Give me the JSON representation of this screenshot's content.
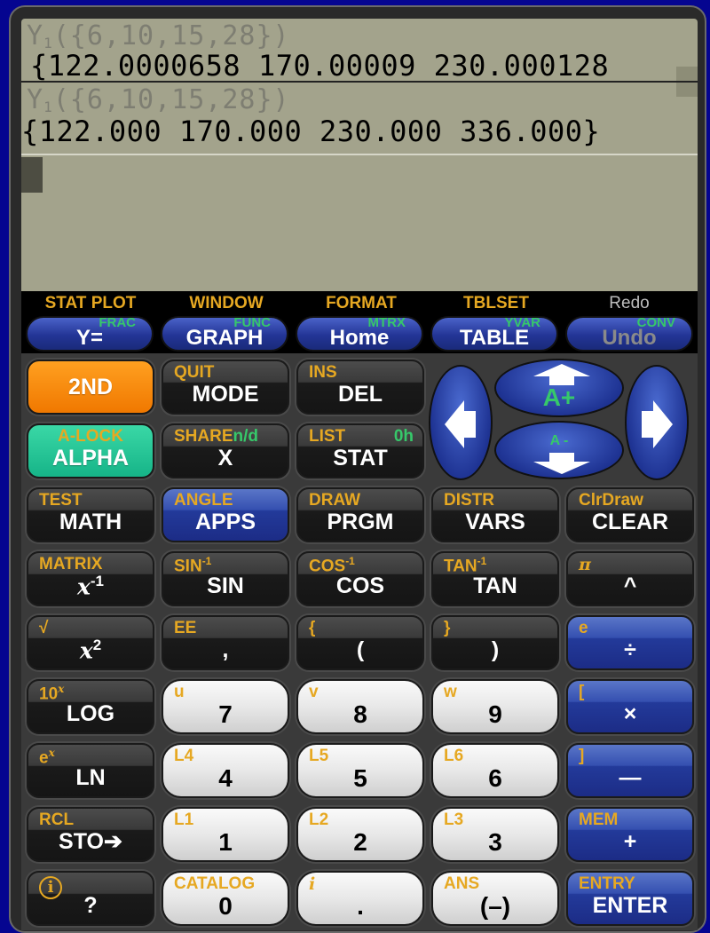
{
  "display": {
    "history": [
      {
        "expression": "Y",
        "subscript": "1",
        "args": "({6,10,15,28})",
        "result": "{122.0000658 170.00009 230.000128"
      },
      {
        "expression": "Y",
        "subscript": "1",
        "args": "({6,10,15,28})",
        "result": "{122.000 170.000 230.000 336.000}"
      }
    ]
  },
  "function_row": [
    {
      "second": "STAT PLOT",
      "alpha": "FRAC",
      "main": "Y="
    },
    {
      "second": "WINDOW",
      "alpha": "FUNC",
      "main": "GRAPH"
    },
    {
      "second": "FORMAT",
      "alpha": "MTRX",
      "main": "Home"
    },
    {
      "second": "TBLSET",
      "alpha": "YVAR",
      "main": "TABLE"
    },
    {
      "second": "Redo",
      "alpha": "CONV",
      "main": "Undo"
    }
  ],
  "dpad": {
    "up_label": "A+",
    "down_label": "A -"
  },
  "keys": {
    "second": {
      "main": "2ND"
    },
    "mode": {
      "second": "QUIT",
      "main": "MODE"
    },
    "del": {
      "second": "INS",
      "main": "DEL"
    },
    "alpha": {
      "second": "A-LOCK",
      "main": "ALPHA"
    },
    "x": {
      "second": "SHARE",
      "alpha": "n/d",
      "main": "X"
    },
    "stat": {
      "second": "LIST",
      "alpha": "0h",
      "main": "STAT"
    },
    "math": {
      "second": "TEST",
      "main": "MATH"
    },
    "apps": {
      "second": "ANGLE",
      "main": "APPS"
    },
    "prgm": {
      "second": "DRAW",
      "main": "PRGM"
    },
    "vars": {
      "second": "DISTR",
      "main": "VARS"
    },
    "clear": {
      "second": "ClrDraw",
      "main": "CLEAR"
    },
    "inverse": {
      "second": "MATRIX",
      "main": "x",
      "sup": "-1"
    },
    "sin": {
      "second": "SIN",
      "second_sup": "-1",
      "main": "SIN"
    },
    "cos": {
      "second": "COS",
      "second_sup": "-1",
      "main": "COS"
    },
    "tan": {
      "second": "TAN",
      "second_sup": "-1",
      "main": "TAN"
    },
    "power": {
      "second": "π",
      "main": "^"
    },
    "square": {
      "second": "√",
      "main": "x",
      "sup": "2"
    },
    "comma": {
      "second": "EE",
      "main": ","
    },
    "lparen": {
      "second": "{",
      "main": "("
    },
    "rparen": {
      "second": "}",
      "main": ")"
    },
    "divide": {
      "second": "e",
      "main": "÷"
    },
    "log": {
      "second": "10",
      "second_sup": "x",
      "main": "LOG"
    },
    "seven": {
      "second": "u",
      "main": "7"
    },
    "eight": {
      "second": "v",
      "main": "8"
    },
    "nine": {
      "second": "w",
      "main": "9"
    },
    "multiply": {
      "second": "[",
      "main": "×"
    },
    "ln": {
      "second": "e",
      "second_sup": "x",
      "main": "LN"
    },
    "four": {
      "second": "L4",
      "main": "4"
    },
    "five": {
      "second": "L5",
      "main": "5"
    },
    "six": {
      "second": "L6",
      "main": "6"
    },
    "subtract": {
      "second": "]",
      "main": "—"
    },
    "sto": {
      "second": "RCL",
      "main": "STO➔"
    },
    "one": {
      "second": "L1",
      "main": "1"
    },
    "two": {
      "second": "L2",
      "main": "2"
    },
    "three": {
      "second": "L3",
      "main": "3"
    },
    "add": {
      "second": "MEM",
      "main": "+"
    },
    "help": {
      "second": "i",
      "main": "?"
    },
    "zero": {
      "second": "CATALOG",
      "main": "0"
    },
    "decimal": {
      "second": "i",
      "main": "."
    },
    "negate": {
      "second": "ANS",
      "main": "(–)"
    },
    "enter": {
      "second": "ENTRY",
      "main": "ENTER"
    }
  }
}
